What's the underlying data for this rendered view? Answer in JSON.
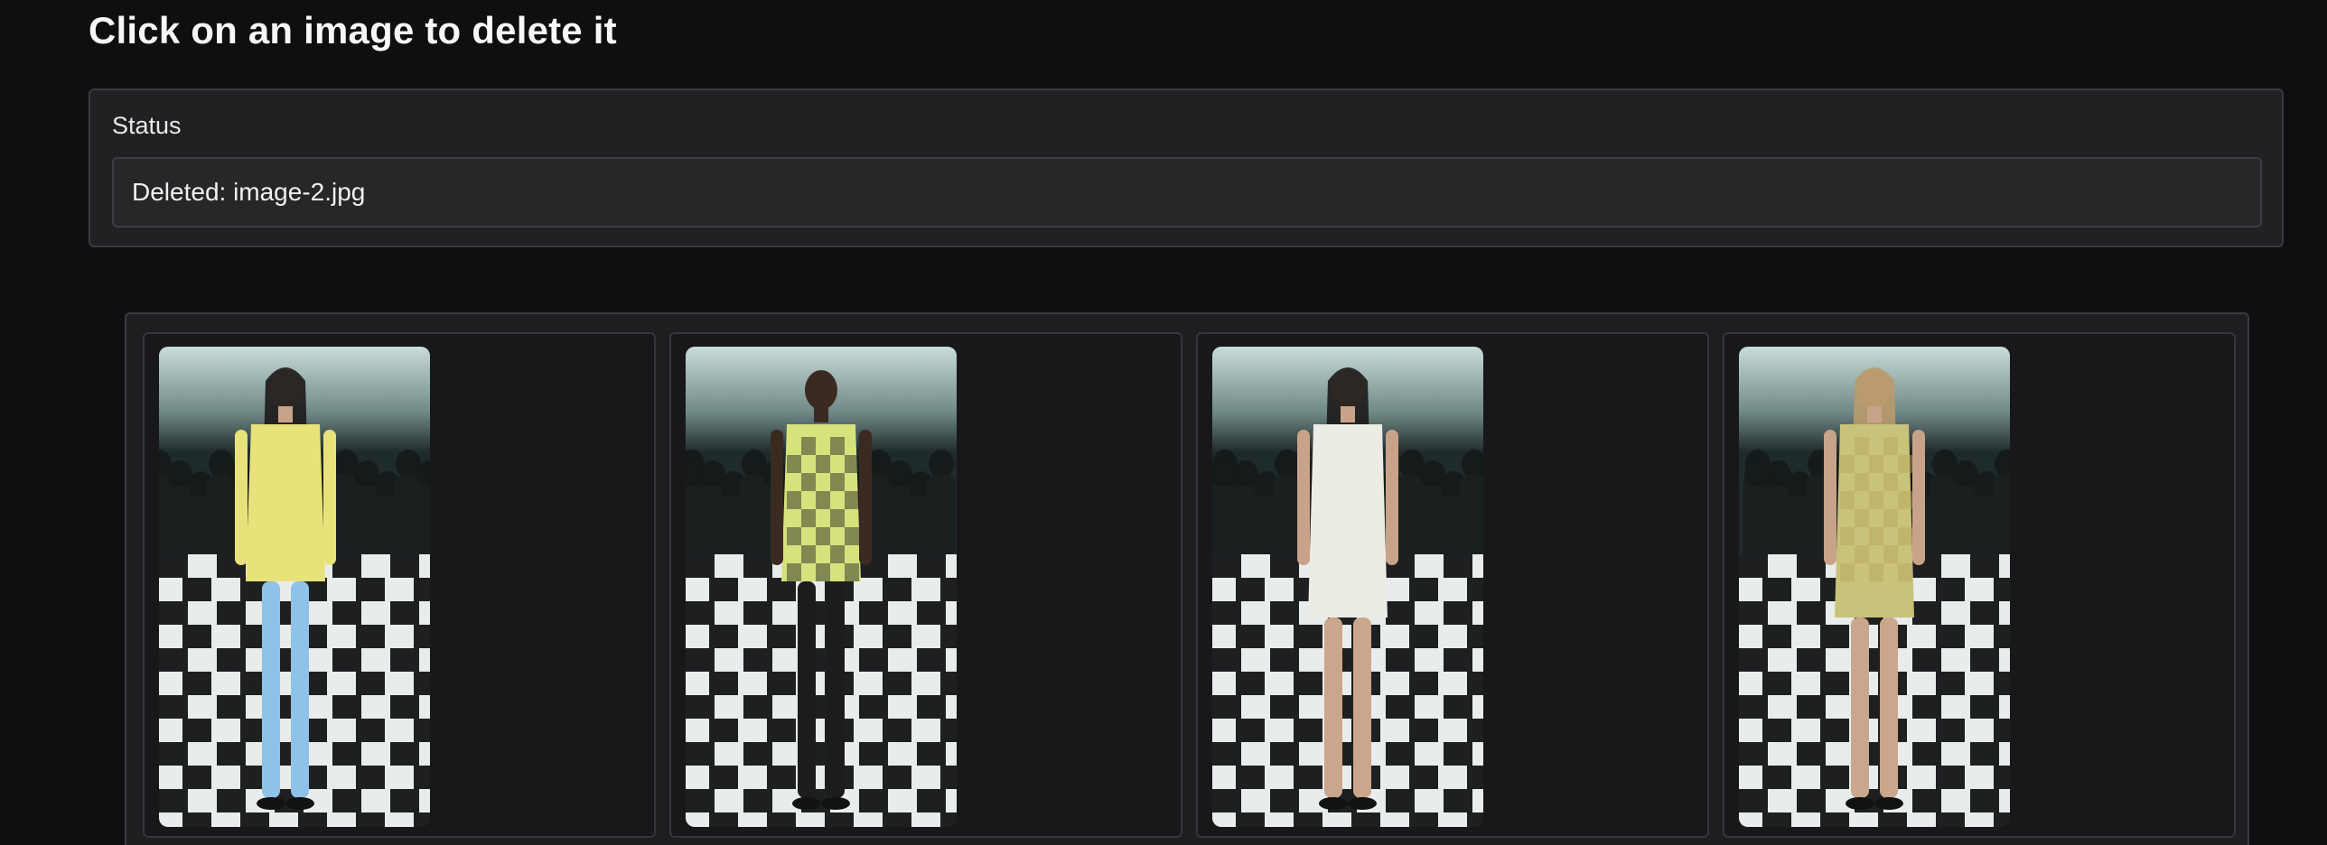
{
  "page": {
    "title": "Click on an image to delete it"
  },
  "status": {
    "label": "Status",
    "value": "Deleted: image-2.jpg"
  },
  "gallery": {
    "items": [
      {
        "subject": "runway-model-yellow-jacket-sunglasses",
        "outfit_color": "#e8e27a",
        "accent_color": "#8fc2e8"
      },
      {
        "subject": "runway-model-checkered-vest",
        "outfit_color": "#d7e27d",
        "accent_color": "#1b1b1d"
      },
      {
        "subject": "runway-model-white-mini-dress",
        "outfit_color": "#ecebe4",
        "accent_color": "#d9cf86"
      },
      {
        "subject": "runway-model-checkered-slip-dress",
        "outfit_color": "#c9c27a",
        "accent_color": "#b9a65a"
      }
    ]
  }
}
